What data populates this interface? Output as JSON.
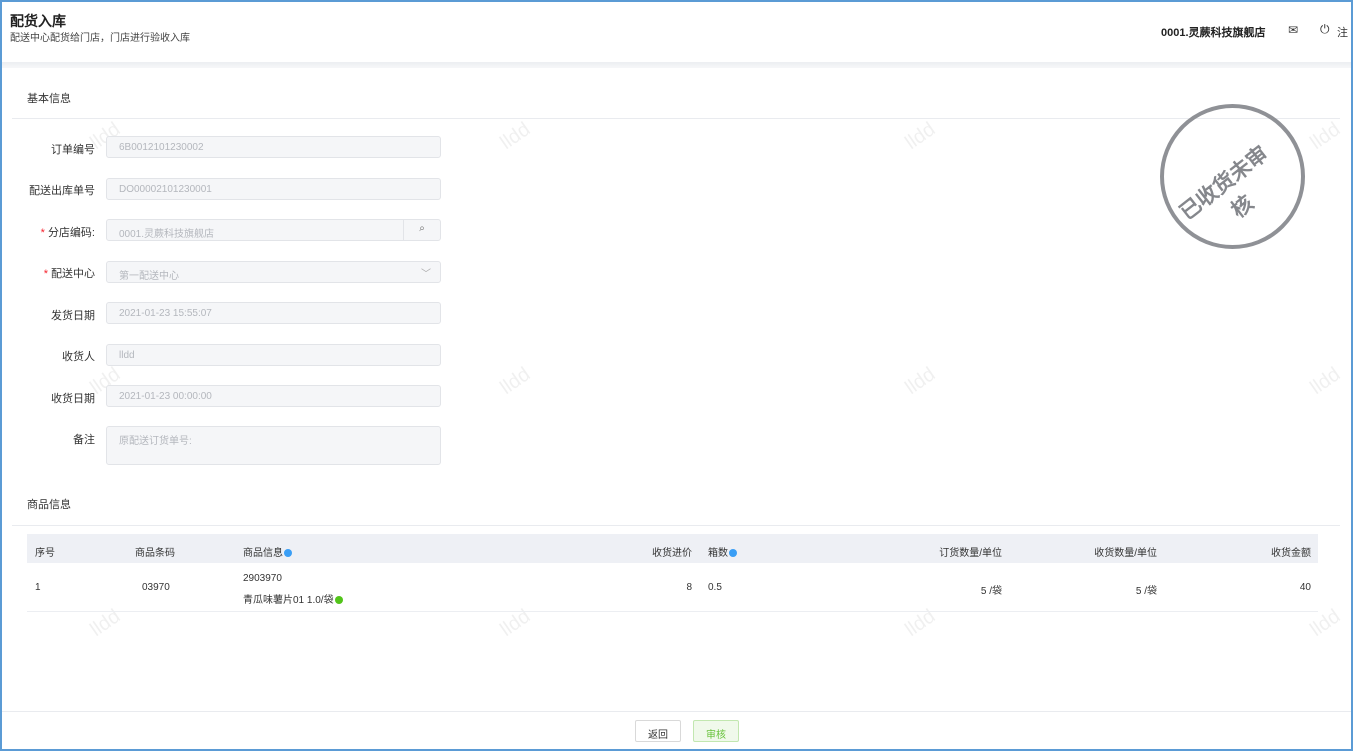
{
  "header": {
    "title": "配货入库",
    "subtitle": "配送中心配货给门店，门店进行验收入库",
    "store": "0001.灵蕨科技旗舰店",
    "logout": "注"
  },
  "sections": {
    "basic": "基本信息",
    "goods": "商品信息"
  },
  "stamp": "已收货未审核",
  "watermark": "lldd",
  "form": [
    {
      "label": "订单编号",
      "value": "6B0012101230002",
      "required": false
    },
    {
      "label": "配送出库单号",
      "value": "DO00002101230001",
      "required": false
    },
    {
      "label": "分店编码:",
      "value": "0001.灵蕨科技旗舰店",
      "required": true
    },
    {
      "label": "配送中心",
      "value": "第一配送中心",
      "required": true
    },
    {
      "label": "发货日期",
      "value": "2021-01-23 15:55:07",
      "required": false
    },
    {
      "label": "收货人",
      "value": "lldd",
      "required": false
    },
    {
      "label": "收货日期",
      "value": "2021-01-23 00:00:00",
      "required": false
    },
    {
      "label": "备注",
      "placeholder": "原配送订货单号:",
      "required": false
    }
  ],
  "table": {
    "columns": [
      "序号",
      "商品条码",
      "商品信息",
      "收货进价",
      "箱数",
      "订货数量/单位",
      "收货数量/单位",
      "收货金额"
    ],
    "rows": [
      {
        "no": "1",
        "barcode": "03970",
        "code": "2903970",
        "name": "青瓜味薯片01 1.0/袋",
        "price": "8",
        "boxes": "0.5",
        "order_qty": "5 /袋",
        "recv_qty": "5 /袋",
        "amount": "40"
      }
    ]
  },
  "footer": {
    "back": "返回",
    "approve": "审核"
  }
}
